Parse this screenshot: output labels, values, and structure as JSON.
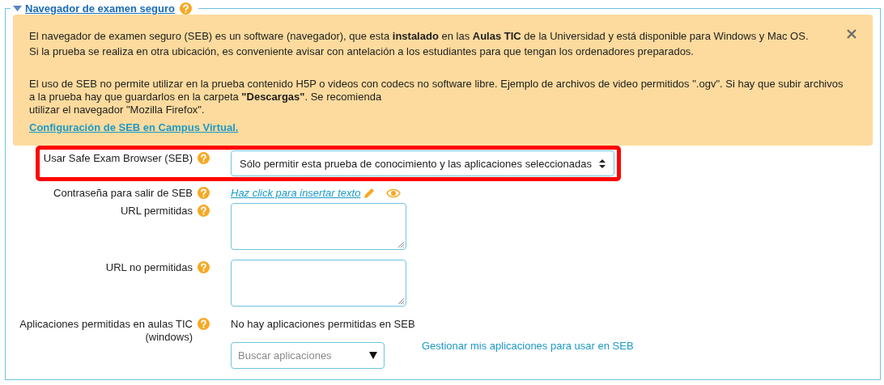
{
  "section": {
    "title": "Navegador de examen seguro",
    "expanded": true
  },
  "alert": {
    "blocks": [
      {
        "lines": [
          "El navegador de examen seguro (SEB) es un software (navegador), que esta **instalado** en las **Aulas TIC** de la Universidad y está disponible para Windows y Mac OS.",
          "Si la prueba se realiza en otra ubicación, es conveniente avisar con antelación a los estudiantes para que tengan los ordenadores preparados."
        ]
      },
      {
        "lines": [
          "El uso de SEB no permite utilizar en la prueba contenido H5P o videos con codecs no software libre. Ejemplo de archivos de video permitidos \".ogv\". Si hay que subir archivos",
          "a la prueba hay que guardarlos en la carpeta **\"Descargas\"**. Se recomienda",
          "utilizar el navegador \"Mozilla Firefox\"."
        ]
      }
    ],
    "link": "Configuración de SEB en Campus Virtual.",
    "dismissible": true
  },
  "fields": [
    {
      "kind": "select",
      "label": "Usar Safe Exam Browser (SEB)",
      "value": "Sólo permitir esta prueba de conocimiento y las aplicaciones seleccionadas",
      "highlighted": true
    },
    {
      "kind": "editable",
      "label": "Contraseña para salir de SEB",
      "link": "Haz click para insertar texto",
      "highlighted": false
    },
    {
      "kind": "textarea",
      "label": "URL permitidas",
      "highlighted": false
    },
    {
      "kind": "textarea",
      "label": "URL no permitidas",
      "highlighted": false
    },
    {
      "kind": "apps",
      "label": "Aplicaciones permitidas en aulas TIC",
      "label_2": "(windows)",
      "message": "No hay aplicaciones permitidas en SEB",
      "placeholder": "Buscar aplicaciones",
      "link": "Gestionar mis aplicaciones para usar en SEB",
      "highlighted": false
    }
  ]
}
